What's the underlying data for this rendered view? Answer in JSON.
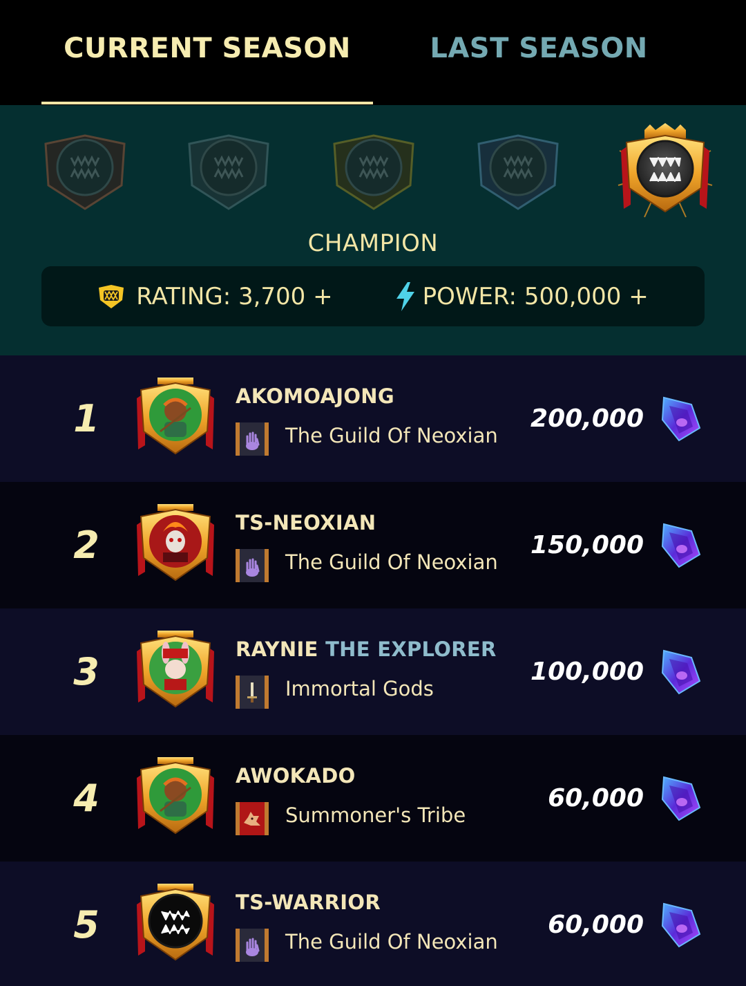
{
  "tabs": {
    "current": "CURRENT SEASON",
    "last": "LAST SEASON"
  },
  "league": {
    "icons": [
      "bronze-league-icon",
      "silver-league-icon",
      "gold-league-icon",
      "diamond-league-icon",
      "champion-league-icon"
    ],
    "selected": "CHAMPION",
    "rating_label": "RATING: 3,700 +",
    "power_label": "POWER: 500,000 +"
  },
  "colors": {
    "accent": "#f3e6a6",
    "tab_inactive": "#74a9b2",
    "league_bg": "#052f30",
    "crystal": "#6a3be0"
  },
  "leaderboard": [
    {
      "rank": "1",
      "name": "AKOMOAJONG",
      "name_accent": "",
      "guild": "The Guild Of Neoxian",
      "guild_icon": "hand-banner-icon",
      "reward": "200,000",
      "avatar": "archer-avatar-icon"
    },
    {
      "rank": "2",
      "name": "TS-NEOXIAN",
      "name_accent": "",
      "guild": "The Guild Of Neoxian",
      "guild_icon": "hand-banner-icon",
      "reward": "150,000",
      "avatar": "skull-avatar-icon"
    },
    {
      "rank": "3",
      "name": "RAYNIE",
      "name_accent": "THE EXPLORER",
      "guild": "Immortal Gods",
      "guild_icon": "sword-banner-icon",
      "reward": "100,000",
      "avatar": "rabbit-avatar-icon"
    },
    {
      "rank": "4",
      "name": "AWOKADO",
      "name_accent": "",
      "guild": "Summoner's Tribe",
      "guild_icon": "wolf-banner-icon",
      "reward": "60,000",
      "avatar": "archer-avatar-icon"
    },
    {
      "rank": "5",
      "name": "TS-WARRIOR",
      "name_accent": "",
      "guild": "The Guild Of Neoxian",
      "guild_icon": "hand-banner-icon",
      "reward": "60,000",
      "avatar": "fangs-avatar-icon"
    }
  ]
}
